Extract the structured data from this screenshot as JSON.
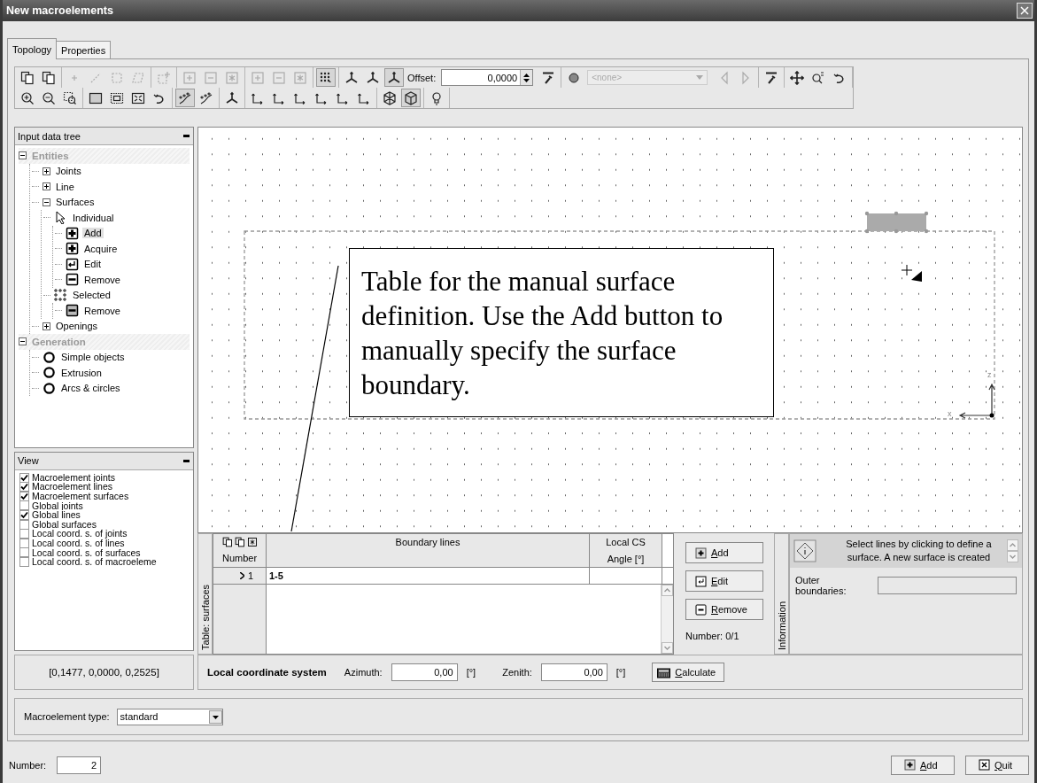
{
  "window": {
    "title": "New macroelements"
  },
  "tabs": [
    {
      "label": "Topology",
      "selected": true
    },
    {
      "label": "Properties",
      "selected": false
    }
  ],
  "toolbar": {
    "rows": [
      [
        {
          "items": [
            {
              "kind": "copy-doc",
              "disabled": false,
              "pressed": false
            },
            {
              "kind": "paste",
              "disabled": false,
              "pressed": false
            }
          ]
        },
        {
          "items": [
            {
              "kind": "plus",
              "disabled": true,
              "pressed": false
            },
            {
              "kind": "line",
              "disabled": true,
              "pressed": false
            },
            {
              "kind": "square",
              "disabled": true,
              "pressed": false
            },
            {
              "kind": "para",
              "disabled": true,
              "pressed": false
            }
          ]
        },
        {
          "items": [
            {
              "kind": "grid-plus",
              "disabled": true,
              "pressed": false
            }
          ]
        },
        {
          "items": [
            {
              "kind": "box-plus",
              "disabled": true,
              "pressed": false
            },
            {
              "kind": "box-minus",
              "disabled": true,
              "pressed": false
            },
            {
              "kind": "box-star",
              "disabled": true,
              "pressed": false
            }
          ]
        },
        {
          "items": [
            {
              "kind": "box-plus",
              "disabled": true,
              "pressed": false
            },
            {
              "kind": "box-minus",
              "disabled": true,
              "pressed": false
            },
            {
              "kind": "box-star",
              "disabled": true,
              "pressed": false
            }
          ]
        },
        {
          "items": [
            {
              "kind": "dots",
              "disabled": false,
              "pressed": true
            }
          ]
        },
        {
          "items": [
            {
              "kind": "axes",
              "disabled": false,
              "pressed": false
            },
            {
              "kind": "axes",
              "disabled": false,
              "pressed": false
            },
            {
              "kind": "axes",
              "disabled": false,
              "pressed": true
            },
            {
              "kind": "label",
              "text": "Offset:"
            },
            {
              "kind": "spin",
              "value": "0,0000"
            },
            {
              "kind": "wrench",
              "disabled": false,
              "pressed": false
            }
          ]
        },
        {
          "items": [
            {
              "kind": "circle",
              "disabled": false,
              "pressed": false
            },
            {
              "kind": "select",
              "value": "<none>",
              "disabled": true
            },
            {
              "kind": "arrow-left",
              "disabled": true,
              "pressed": false
            },
            {
              "kind": "arrow-right",
              "disabled": true,
              "pressed": false
            }
          ]
        },
        {
          "items": [
            {
              "kind": "wrench",
              "disabled": false,
              "pressed": false
            }
          ]
        },
        {
          "items": [
            {
              "kind": "move",
              "disabled": false,
              "pressed": false
            },
            {
              "kind": "zoom",
              "disabled": false,
              "pressed": false
            },
            {
              "kind": "rotate",
              "disabled": false,
              "pressed": false
            }
          ]
        }
      ],
      [
        {
          "items": [
            {
              "kind": "zoom-in",
              "disabled": false,
              "pressed": false
            },
            {
              "kind": "zoom-out",
              "disabled": false,
              "pressed": false
            },
            {
              "kind": "zoom-window",
              "disabled": false,
              "pressed": false
            }
          ]
        },
        {
          "items": [
            {
              "kind": "rect",
              "disabled": false,
              "pressed": false
            },
            {
              "kind": "rect-inner",
              "disabled": false,
              "pressed": false
            },
            {
              "kind": "fit",
              "disabled": false,
              "pressed": false
            },
            {
              "kind": "rotate",
              "disabled": false,
              "pressed": false
            }
          ]
        },
        {
          "items": [
            {
              "kind": "curve",
              "disabled": false,
              "pressed": true
            },
            {
              "kind": "curve",
              "disabled": false,
              "pressed": false
            }
          ]
        },
        {
          "items": [
            {
              "kind": "axes",
              "disabled": false,
              "pressed": false
            }
          ]
        },
        {
          "items": [
            {
              "kind": "view",
              "disabled": false,
              "pressed": false
            },
            {
              "kind": "view",
              "disabled": false,
              "pressed": false
            },
            {
              "kind": "view",
              "disabled": false,
              "pressed": false
            },
            {
              "kind": "view",
              "disabled": false,
              "pressed": false
            },
            {
              "kind": "view",
              "disabled": false,
              "pressed": false
            },
            {
              "kind": "view",
              "disabled": false,
              "pressed": false
            }
          ]
        },
        {
          "items": [
            {
              "kind": "cube-wire",
              "disabled": false,
              "pressed": false
            },
            {
              "kind": "cube-solid",
              "disabled": false,
              "pressed": true
            }
          ]
        },
        {
          "items": [
            {
              "kind": "bulb",
              "disabled": false,
              "pressed": false
            }
          ]
        }
      ]
    ]
  },
  "tree_panel": {
    "title": "Input data tree",
    "items": [
      {
        "label": "Entities",
        "kind": "header",
        "expanded": true,
        "selected": false,
        "children": [
          {
            "label": "Joints",
            "kind": "plain",
            "expanded": false,
            "selected": false
          },
          {
            "label": "Line",
            "kind": "plain",
            "expanded": false,
            "selected": false
          },
          {
            "label": "Surfaces",
            "kind": "plain",
            "expanded": true,
            "selected": false,
            "children": [
              {
                "label": "Individual",
                "kind": "pointer",
                "selected": false,
                "children": [
                  {
                    "label": "Add",
                    "kind": "add",
                    "selected": true
                  },
                  {
                    "label": "Acquire",
                    "kind": "add",
                    "selected": false
                  },
                  {
                    "label": "Edit",
                    "kind": "edit",
                    "selected": false
                  },
                  {
                    "label": "Remove",
                    "kind": "remove",
                    "selected": false
                  }
                ]
              },
              {
                "label": "Selected",
                "kind": "multi",
                "selected": false,
                "children": [
                  {
                    "label": "Remove",
                    "kind": "remove-grey",
                    "selected": false
                  }
                ]
              }
            ]
          },
          {
            "label": "Openings",
            "kind": "plain",
            "expanded": false,
            "selected": false
          }
        ]
      },
      {
        "label": "Generation",
        "kind": "header",
        "expanded": true,
        "selected": false,
        "children": [
          {
            "label": "Simple objects",
            "kind": "circle",
            "selected": false
          },
          {
            "label": "Extrusion",
            "kind": "circle",
            "selected": false
          },
          {
            "label": "Arcs & circles",
            "kind": "circle",
            "selected": false
          }
        ]
      }
    ]
  },
  "view_panel": {
    "title": "View",
    "items": [
      {
        "label": "Macroelement joints",
        "checked": true
      },
      {
        "label": "Macroelement lines",
        "checked": true
      },
      {
        "label": "Macroelement surfaces",
        "checked": true
      },
      {
        "label": "Global joints",
        "checked": false
      },
      {
        "label": "Global lines",
        "checked": true
      },
      {
        "label": "Global surfaces",
        "checked": false
      },
      {
        "label": "Local coord. s. of joints",
        "checked": false
      },
      {
        "label": "Local coord. s. of lines",
        "checked": false
      },
      {
        "label": "Local coord. s. of surfaces",
        "checked": false
      },
      {
        "label": "Local coord. s. of macroeleme",
        "checked": false
      }
    ]
  },
  "coordinates": "[0,1477, 0,0000, 0,2525]",
  "canvas": {
    "callout": "Table for the manual surface definition. Use the Add button to manually specify the surface boundary.",
    "axis_labels": [
      "z",
      "x"
    ]
  },
  "table": {
    "side_label": "Table: surfaces",
    "columns": [
      {
        "label": "Number"
      },
      {
        "label": "Boundary lines"
      },
      {
        "label": "Local CS",
        "sublabel": "Angle [°]"
      }
    ],
    "rows": [
      {
        "number": "1",
        "boundary": "1-5",
        "selected": true
      }
    ],
    "buttons": [
      {
        "label": "Add",
        "kind": "add"
      },
      {
        "label": "Edit",
        "kind": "edit"
      },
      {
        "label": "Remove",
        "kind": "remove"
      }
    ],
    "count": "Number: 0/1"
  },
  "information": {
    "tab_label": "Information",
    "message": "Select lines by clicking to define a surface. A new surface is created",
    "field_label": "Outer boundaries:"
  },
  "local_cs": {
    "title": "Local coordinate system",
    "fields": [
      {
        "label": "Azimuth:",
        "value": "0,00",
        "unit": "[°]"
      },
      {
        "label": "Zenith:",
        "value": "0,00",
        "unit": "[°]"
      }
    ],
    "button": "Calculate"
  },
  "macro_type": {
    "label": "Macroelement type:",
    "value": "standard"
  },
  "footer": {
    "number_label": "Number:",
    "number_value": "2",
    "buttons": [
      {
        "label": "Add",
        "kind": "add"
      },
      {
        "label": "Quit",
        "kind": "quit"
      }
    ]
  }
}
